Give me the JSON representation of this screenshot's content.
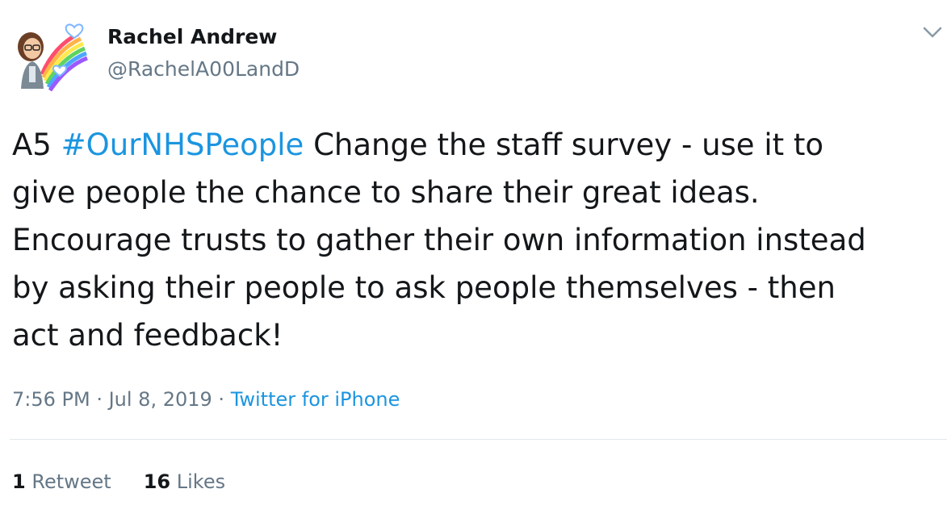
{
  "user": {
    "name": "Rachel Andrew",
    "handle": "@RachelA00LandD",
    "avatar_icon": "bitmoji-avatar-with-rainbow-heart"
  },
  "menu": {
    "icon": "chevron-down-icon"
  },
  "tweet": {
    "lines": [
      {
        "prefix": "A5 ",
        "hashtag": "#OurNHSPeople",
        "suffix": " Change the staff survey - use it to"
      },
      {
        "text": "give people the chance to share their great ideas."
      },
      {
        "text": "Encourage trusts to gather their own information instead"
      },
      {
        "text": "by asking their people to ask people themselves - then"
      },
      {
        "text": "act and feedback!"
      }
    ]
  },
  "meta": {
    "time": "7:56 PM",
    "sep1": " · ",
    "date": "Jul 8, 2019",
    "sep2": " · ",
    "source": "Twitter for iPhone"
  },
  "stats": {
    "retweets_count": "1",
    "retweets_label": "Retweet",
    "likes_count": "16",
    "likes_label": "Likes"
  },
  "colors": {
    "link": "#1b95e0",
    "muted": "#657786",
    "text": "#14171a",
    "divider": "#e1e8ed"
  }
}
